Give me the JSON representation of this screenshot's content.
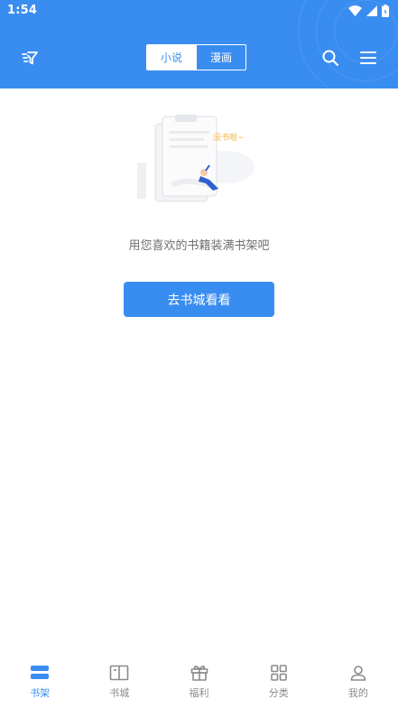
{
  "status_bar": {
    "time": "1:54"
  },
  "header": {
    "filter_icon": "filter-icon",
    "tabs": [
      {
        "label": "小说",
        "active": true
      },
      {
        "label": "漫画",
        "active": false
      }
    ],
    "search_icon": "search-icon",
    "menu_icon": "menu-icon"
  },
  "empty_state": {
    "illustration_text": "没书啦~",
    "message": "用您喜欢的书籍装满书架吧",
    "button_label": "去书城看看"
  },
  "bottom_nav": {
    "items": [
      {
        "label": "书架",
        "icon": "bookshelf-icon",
        "active": true
      },
      {
        "label": "书城",
        "icon": "book-icon",
        "active": false
      },
      {
        "label": "福利",
        "icon": "gift-icon",
        "active": false
      },
      {
        "label": "分类",
        "icon": "grid-icon",
        "active": false
      },
      {
        "label": "我的",
        "icon": "person-icon",
        "active": false
      }
    ]
  },
  "colors": {
    "primary": "#3a8df0",
    "text_muted": "#707070",
    "nav_inactive": "#8a8a8a"
  }
}
